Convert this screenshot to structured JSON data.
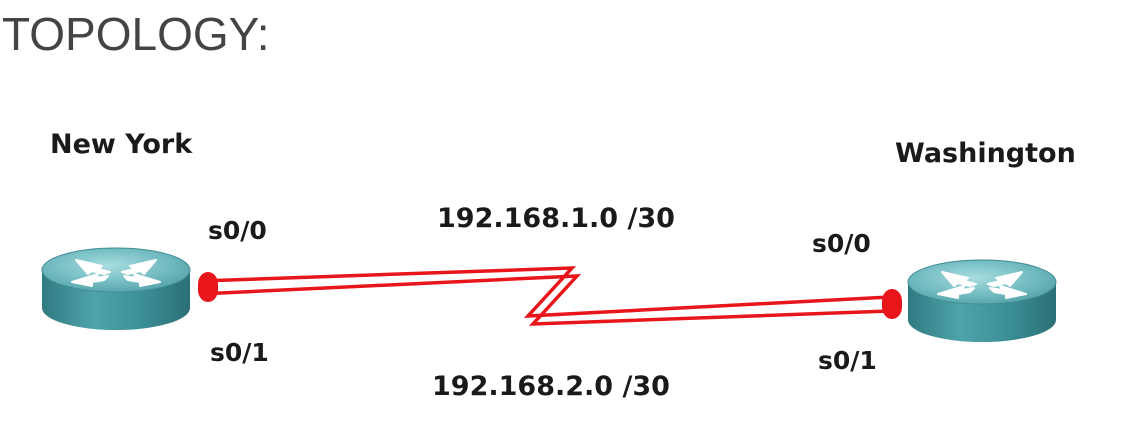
{
  "heading": "TOPOLOGY:",
  "routers": {
    "left": {
      "name": "New York",
      "iface_top": "s0/0",
      "iface_bottom": "s0/1"
    },
    "right": {
      "name": "Washington",
      "iface_top": "s0/0",
      "iface_bottom": "s0/1"
    }
  },
  "networks": {
    "top": "192.168.1.0 /30",
    "bottom": "192.168.2.0 /30"
  },
  "colors": {
    "link": "#e8161b",
    "router_body": "#3f8f96",
    "router_top": "#7dc3c8",
    "heading": "#444444",
    "label": "#1a1a1a"
  },
  "icons": {
    "router": "router-icon"
  }
}
